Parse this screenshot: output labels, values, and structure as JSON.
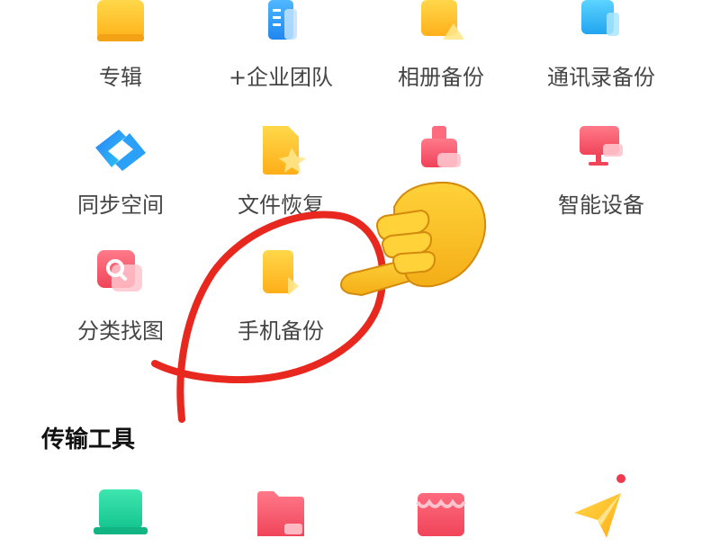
{
  "features": {
    "items": [
      {
        "label": "专辑",
        "icon": "album-icon"
      },
      {
        "label": "+企业团队",
        "icon": "enterprise-team-icon"
      },
      {
        "label": "相册备份",
        "icon": "photo-backup-icon"
      },
      {
        "label": "通讯录备份",
        "icon": "contacts-backup-icon"
      },
      {
        "label": "同步空间",
        "icon": "sync-space-icon"
      },
      {
        "label": "文件恢复",
        "icon": "file-recovery-icon"
      },
      {
        "label": "",
        "icon": "cleanup-icon"
      },
      {
        "label": "智能设备",
        "icon": "smart-device-icon"
      },
      {
        "label": "分类找图",
        "icon": "image-search-icon"
      },
      {
        "label": "手机备份",
        "icon": "phone-backup-icon"
      }
    ]
  },
  "tools_section": {
    "title": "传输工具",
    "items": [
      {
        "icon": "scan-transfer-icon"
      },
      {
        "icon": "folder-transfer-icon"
      },
      {
        "icon": "store-icon"
      },
      {
        "icon": "send-plane-icon"
      }
    ]
  },
  "annotation": {
    "circle_color": "#e8271f",
    "hand_color": "#f6c21c"
  }
}
